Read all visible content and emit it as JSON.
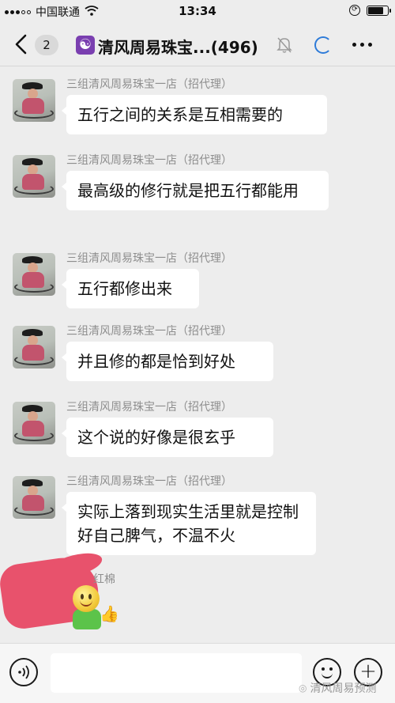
{
  "status_bar": {
    "carrier": "中国联通",
    "time": "13:34"
  },
  "nav": {
    "unread_count": "2",
    "title": "清风周易珠宝...(496)"
  },
  "messages": [
    {
      "sender": "三组清风周易珠宝一店（招代理）",
      "text": "五行之间的关系是互相需要的"
    },
    {
      "sender": "三组清风周易珠宝一店（招代理）",
      "text": "最高级的修行就是把五行都能用"
    },
    {
      "sender": "三组清风周易珠宝一店（招代理）",
      "text": "五行都修出来"
    },
    {
      "sender": "三组清风周易珠宝一店（招代理）",
      "text": "并且修的都是恰到好处"
    },
    {
      "sender": "三组清风周易珠宝一店（招代理）",
      "text": "这个说的好像是很玄乎"
    },
    {
      "sender": "三组清风周易珠宝一店（招代理）",
      "text": "实际上落到现实生活里就是控制好自己脾气，不温不火"
    }
  ],
  "last_message": {
    "sender_partial": "红棉"
  },
  "input": {
    "value": "",
    "placeholder": ""
  },
  "watermark": "清风周易预测",
  "colors": {
    "background": "#ededed",
    "bubble": "#ffffff",
    "accent_loading": "#2e7bd8",
    "group_icon": "#7a3fb0",
    "redaction": "#e8526c"
  }
}
